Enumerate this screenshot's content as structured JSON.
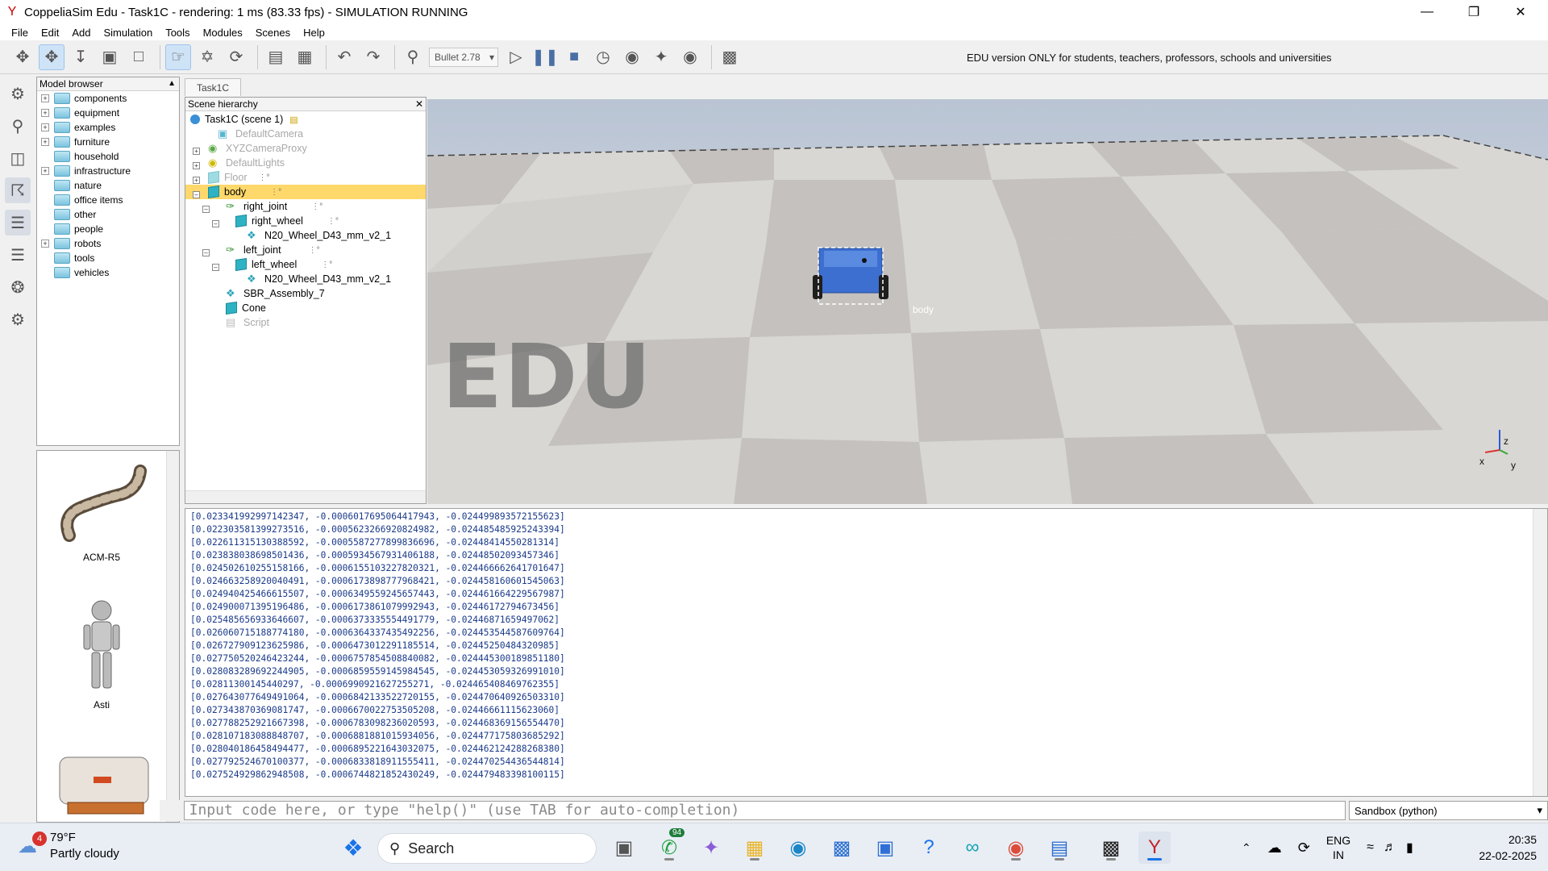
{
  "window": {
    "title": "CoppeliaSim Edu - Task1C - rendering: 1 ms (83.33 fps) - SIMULATION RUNNING"
  },
  "menu": [
    "File",
    "Edit",
    "Add",
    "Simulation",
    "Tools",
    "Modules",
    "Scenes",
    "Help"
  ],
  "toolbar": {
    "engine": "Bullet 2.78",
    "edu_note": "EDU version ONLY for students, teachers, professors, schools and universities"
  },
  "model_browser": {
    "title": "Model browser",
    "items": [
      {
        "label": "components",
        "expandable": true
      },
      {
        "label": "equipment",
        "expandable": true
      },
      {
        "label": "examples",
        "expandable": true
      },
      {
        "label": "furniture",
        "expandable": true
      },
      {
        "label": "household",
        "expandable": false
      },
      {
        "label": "infrastructure",
        "expandable": true
      },
      {
        "label": "nature",
        "expandable": false
      },
      {
        "label": "office items",
        "expandable": false
      },
      {
        "label": "other",
        "expandable": false
      },
      {
        "label": "people",
        "expandable": false
      },
      {
        "label": "robots",
        "expandable": true
      },
      {
        "label": "tools",
        "expandable": false
      },
      {
        "label": "vehicles",
        "expandable": false
      }
    ],
    "thumbnails": [
      "ACM-R5",
      "Asti"
    ]
  },
  "scene": {
    "tab": "Task1C",
    "hierarchy_title": "Scene hierarchy",
    "rows": [
      {
        "label": "Task1C (scene 1)"
      },
      {
        "label": "DefaultCamera"
      },
      {
        "label": "XYZCameraProxy"
      },
      {
        "label": "DefaultLights"
      },
      {
        "label": "Floor"
      },
      {
        "label": "body"
      },
      {
        "label": "right_joint"
      },
      {
        "label": "right_wheel"
      },
      {
        "label": "N20_Wheel_D43_mm_v2_1"
      },
      {
        "label": "left_joint"
      },
      {
        "label": "left_wheel"
      },
      {
        "label": "N20_Wheel_D43_mm_v2_1"
      },
      {
        "label": "SBR_Assembly_7"
      },
      {
        "label": "Cone"
      },
      {
        "label": "Script"
      }
    ]
  },
  "viewport": {
    "watermark": "EDU",
    "object_label": "body",
    "axes": {
      "x": "x",
      "y": "y",
      "z": "z"
    }
  },
  "console": {
    "lines": [
      "[0.023341992997142347, -0.0006017695064417943, -0.024499893572155623]",
      "[0.022303581399273516, -0.0005623266920824982, -0.024485485925243394]",
      "[0.022611315130388592, -0.0005587277899836696, -0.02448414550281314]",
      "[0.023838038698501436, -0.0005934567931406188, -0.02448502093457346]",
      "[0.024502610255158166, -0.0006155103227820321, -0.024466662641701647]",
      "[0.024663258920040491, -0.0006173898777968421, -0.024458160601545063]",
      "[0.024940425466615507, -0.0006349559245657443, -0.024461664229567987]",
      "[0.024900071395196486, -0.0006173861079992943, -0.02446172794673456]",
      "[0.025485656933646607, -0.0006373335554491779, -0.02446871659497062]",
      "[0.026060715188774180, -0.0006364337435492256, -0.024453544587609764]",
      "[0.026727909123625986, -0.0006473012291185514, -0.02445250484320985]",
      "[0.027750520246423244, -0.0006757854508840082, -0.024445300189851180]",
      "[0.028083289692244905, -0.0006859559145984545, -0.024453059326991010]",
      "[0.02811300145440297, -0.0006990921627255271, -0.024465408469762355]",
      "[0.027643077649491064, -0.0006842133522720155, -0.024470640926503310]",
      "[0.027343870369081747, -0.0006670022753505208, -0.02446661115623060]",
      "[0.027788252921667398, -0.0006783098236020593, -0.024468369156554470]",
      "[0.028107183088848707, -0.0006881881015934056, -0.024477175803685292]",
      "[0.028040186458494477, -0.0006895221643032075, -0.024462124288268380]",
      "[0.027792524670100377, -0.0006833818911555411, -0.024470254436544814]",
      "[0.027524929862948508, -0.0006744821852430249, -0.024479483398100115]"
    ]
  },
  "command": {
    "placeholder": "Input code here, or type \"help()\" (use TAB for auto-completion)",
    "language": "Sandbox (python)"
  },
  "taskbar": {
    "weather_temp": "79°F",
    "weather_desc": "Partly cloudy",
    "weather_badge": "4",
    "search": "Search",
    "whatsapp_badge": "94",
    "lang": "ENG",
    "region": "IN",
    "time": "20:35",
    "date": "22-02-2025"
  }
}
